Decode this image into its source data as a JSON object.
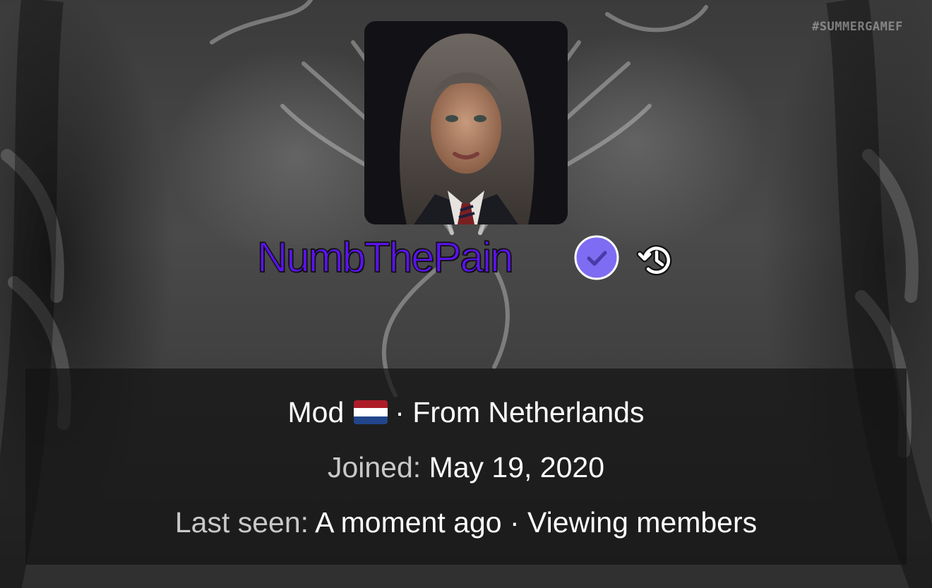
{
  "watermark": "#SUMMERGAMEF",
  "profile": {
    "username": "NumbThePain",
    "role": "Mod",
    "location_sep": "·",
    "location": "From Netherlands",
    "joined_label": "Joined:",
    "joined_value": "May 19, 2020",
    "last_seen_label": "Last seen:",
    "last_seen_value": "A moment ago",
    "activity_sep": "·",
    "activity": "Viewing members"
  },
  "icons": {
    "verified": "verified-check-icon",
    "history": "history-icon",
    "flag": "netherlands-flag-icon"
  },
  "colors": {
    "username": "#5b12f0",
    "verified_badge": "#7e6cf2",
    "flag_red": "#ae1c28",
    "flag_white": "#ffffff",
    "flag_blue": "#21468b"
  }
}
